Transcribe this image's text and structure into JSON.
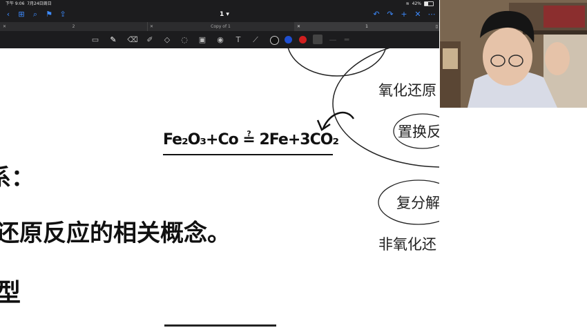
{
  "status_bar": {
    "time": "下午 9:06",
    "date": "7月24日周日",
    "battery_text": "42%",
    "battery_level": 0.42
  },
  "nav_bar": {
    "doc_title": "1",
    "icons": [
      "back-icon",
      "grid-icon",
      "search-icon",
      "bookmark-icon",
      "share-icon",
      "undo-icon",
      "redo-icon",
      "add-page-icon",
      "close-icon",
      "more-icon"
    ]
  },
  "tab_bar": {
    "tabs": [
      {
        "label": "2"
      },
      {
        "label": "Copy of 1"
      },
      {
        "label": "1"
      }
    ]
  },
  "toolbar": {
    "tools": [
      "reader-icon",
      "pen-icon",
      "eraser-icon",
      "highlighter-icon",
      "shapes-icon",
      "lasso-icon",
      "image-icon",
      "camera-icon",
      "text-icon",
      "laser-icon"
    ],
    "colors": [
      "#111111",
      "#1f4fd1",
      "#d11f1f",
      "#444444"
    ]
  },
  "canvas": {
    "equation": "Fe₂O₃+Co ≟ 2Fe+3CO₂",
    "line1": "系：",
    "line2": "还原反应的相关概念。",
    "line3": "型",
    "side1": "氧化还原",
    "side2": "置换反",
    "side3": "复分解",
    "side4": "非氧化还"
  }
}
